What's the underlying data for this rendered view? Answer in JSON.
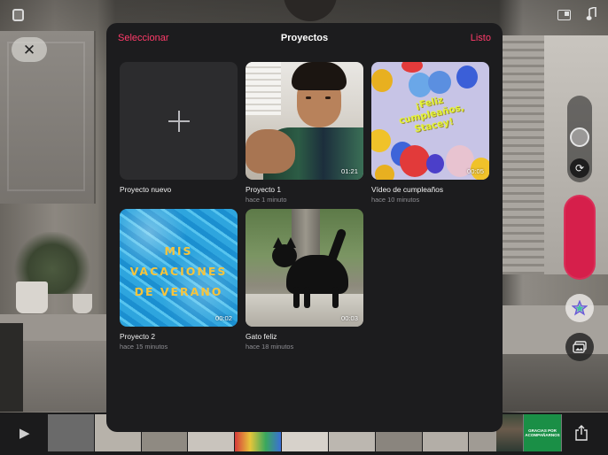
{
  "modal": {
    "title": "Proyectos",
    "select_label": "Seleccionar",
    "done_label": "Listo"
  },
  "projects": [
    {
      "title": "Proyecto nuevo",
      "subtitle": "",
      "duration": ""
    },
    {
      "title": "Proyecto 1",
      "subtitle": "hace 1 minuto",
      "duration": "01:21"
    },
    {
      "title": "Vídeo de cumpleaños",
      "subtitle": "hace 10 minutos",
      "duration": "00:05"
    },
    {
      "title": "Proyecto 2",
      "subtitle": "hace 15 minutos",
      "duration": "00:02"
    },
    {
      "title": "Gato feliz",
      "subtitle": "hace 18 minutos",
      "duration": "00:03"
    }
  ],
  "thumb_text": {
    "birthday": "¡Feliz cumpleaños, Stacey!",
    "vacation_lines": [
      "MIS",
      "VACACIONES",
      "DE VERANO"
    ]
  },
  "timeline": {
    "end_card_text": "GRACIAS POR ACOMPAÑARNOS"
  },
  "colors": {
    "accent": "#ff3b6a",
    "record": "#d61f4b",
    "modal_bg": "#1c1c1e"
  },
  "icons": {
    "close": "close-icon",
    "play": "play-icon",
    "share": "share-icon",
    "music": "music-note-icon",
    "layout": "aspect-ratio-icon",
    "flip": "camera-flip-icon",
    "effects": "star-effects-icon",
    "media": "media-library-icon",
    "new_project": "plus-icon"
  }
}
